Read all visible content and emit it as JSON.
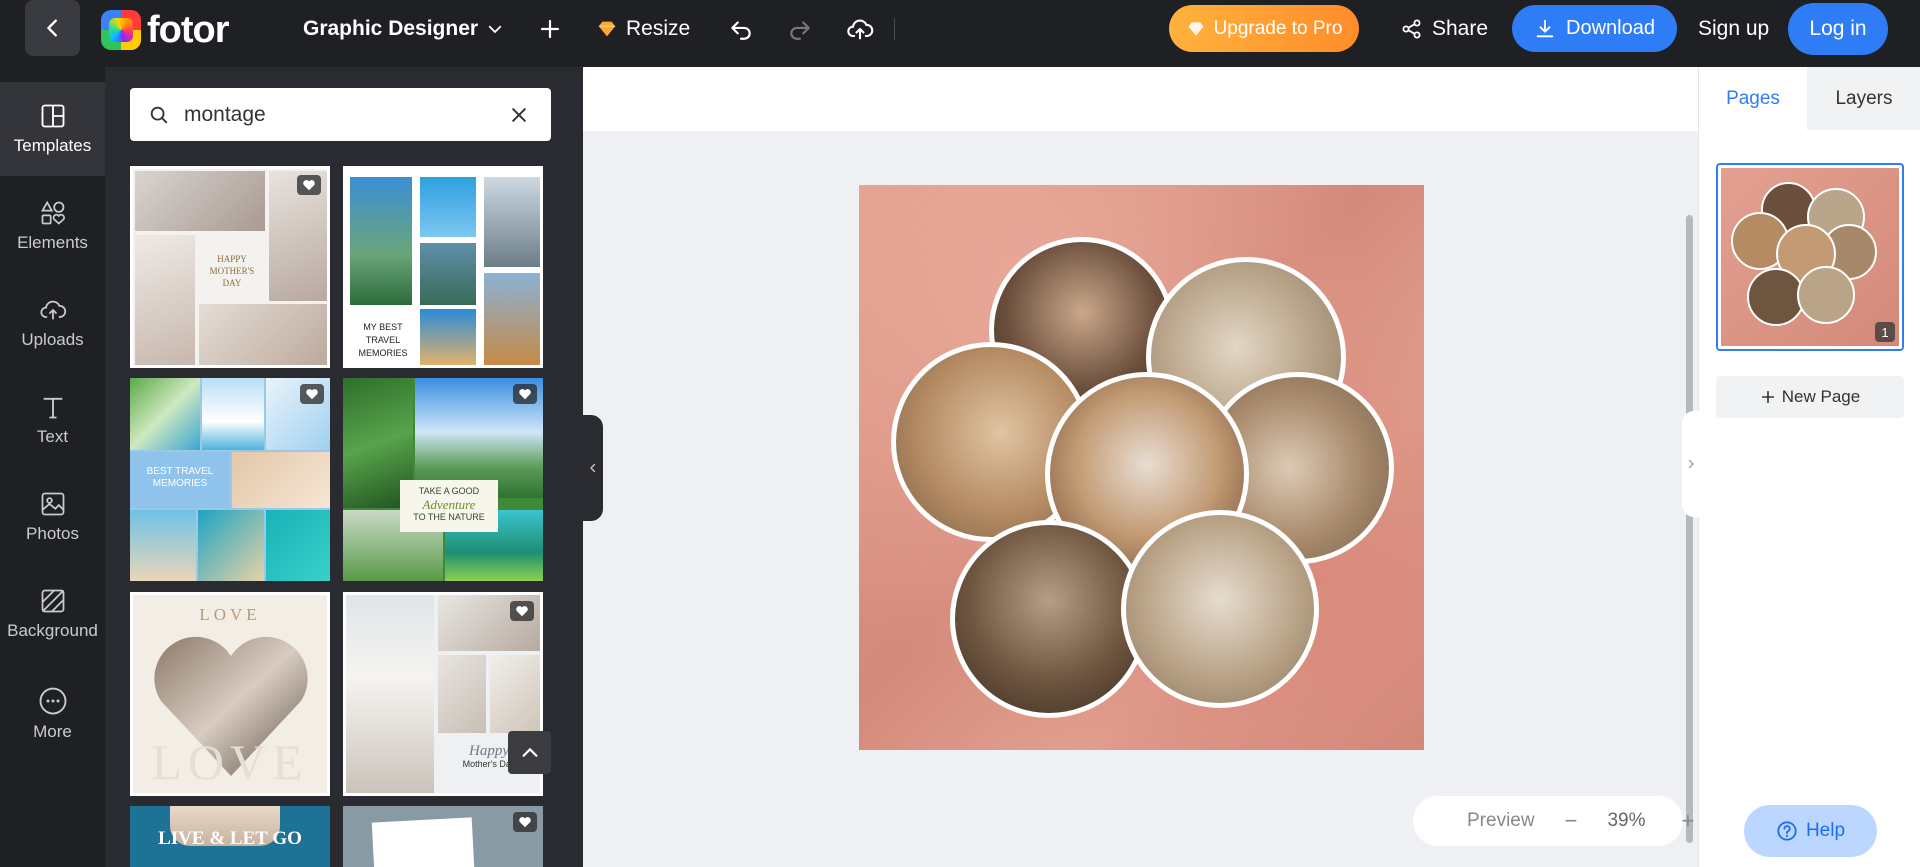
{
  "topbar": {
    "logo_text": "fotor",
    "mode_label": "Graphic Designer",
    "resize_label": "Resize",
    "upgrade_label": "Upgrade to Pro",
    "share_label": "Share",
    "download_label": "Download",
    "signup_label": "Sign up",
    "login_label": "Log in"
  },
  "sidebar": {
    "items": [
      {
        "label": "Templates",
        "icon": "templates-icon"
      },
      {
        "label": "Elements",
        "icon": "elements-icon"
      },
      {
        "label": "Uploads",
        "icon": "upload-icon"
      },
      {
        "label": "Text",
        "icon": "text-icon"
      },
      {
        "label": "Photos",
        "icon": "photos-icon"
      },
      {
        "label": "Background",
        "icon": "background-icon"
      },
      {
        "label": "More",
        "icon": "more-icon"
      }
    ]
  },
  "search": {
    "value": "montage"
  },
  "templates": [
    {
      "caption_lines": [
        "HAPPY",
        "MOTHER'S",
        "DAY"
      ]
    },
    {
      "caption_lines": [
        "MY BEST",
        "TRAVEL",
        "MEMORIES"
      ]
    },
    {
      "caption_lines": [
        "BEST TRAVEL",
        "MEMORIES"
      ]
    },
    {
      "caption_lines": [
        "TAKE A GOOD",
        "Adventure",
        "TO THE NATURE"
      ]
    },
    {
      "caption_lines": [
        "LOVE",
        "LOVE"
      ]
    },
    {
      "caption_lines": [
        "Happy",
        "Mother's Day"
      ]
    },
    {
      "caption_lines": [
        "LIVE & LET GO"
      ]
    },
    {
      "caption_lines": []
    }
  ],
  "right_panel": {
    "tabs": [
      "Pages",
      "Layers"
    ],
    "page_number": "1",
    "new_page_label": "New Page"
  },
  "zoom": {
    "preview_label": "Preview",
    "level": "39%"
  },
  "help_label": "Help",
  "colors": {
    "accent": "#2f7df6",
    "topbar": "#1f2024",
    "upgrade": "#ffa733"
  }
}
